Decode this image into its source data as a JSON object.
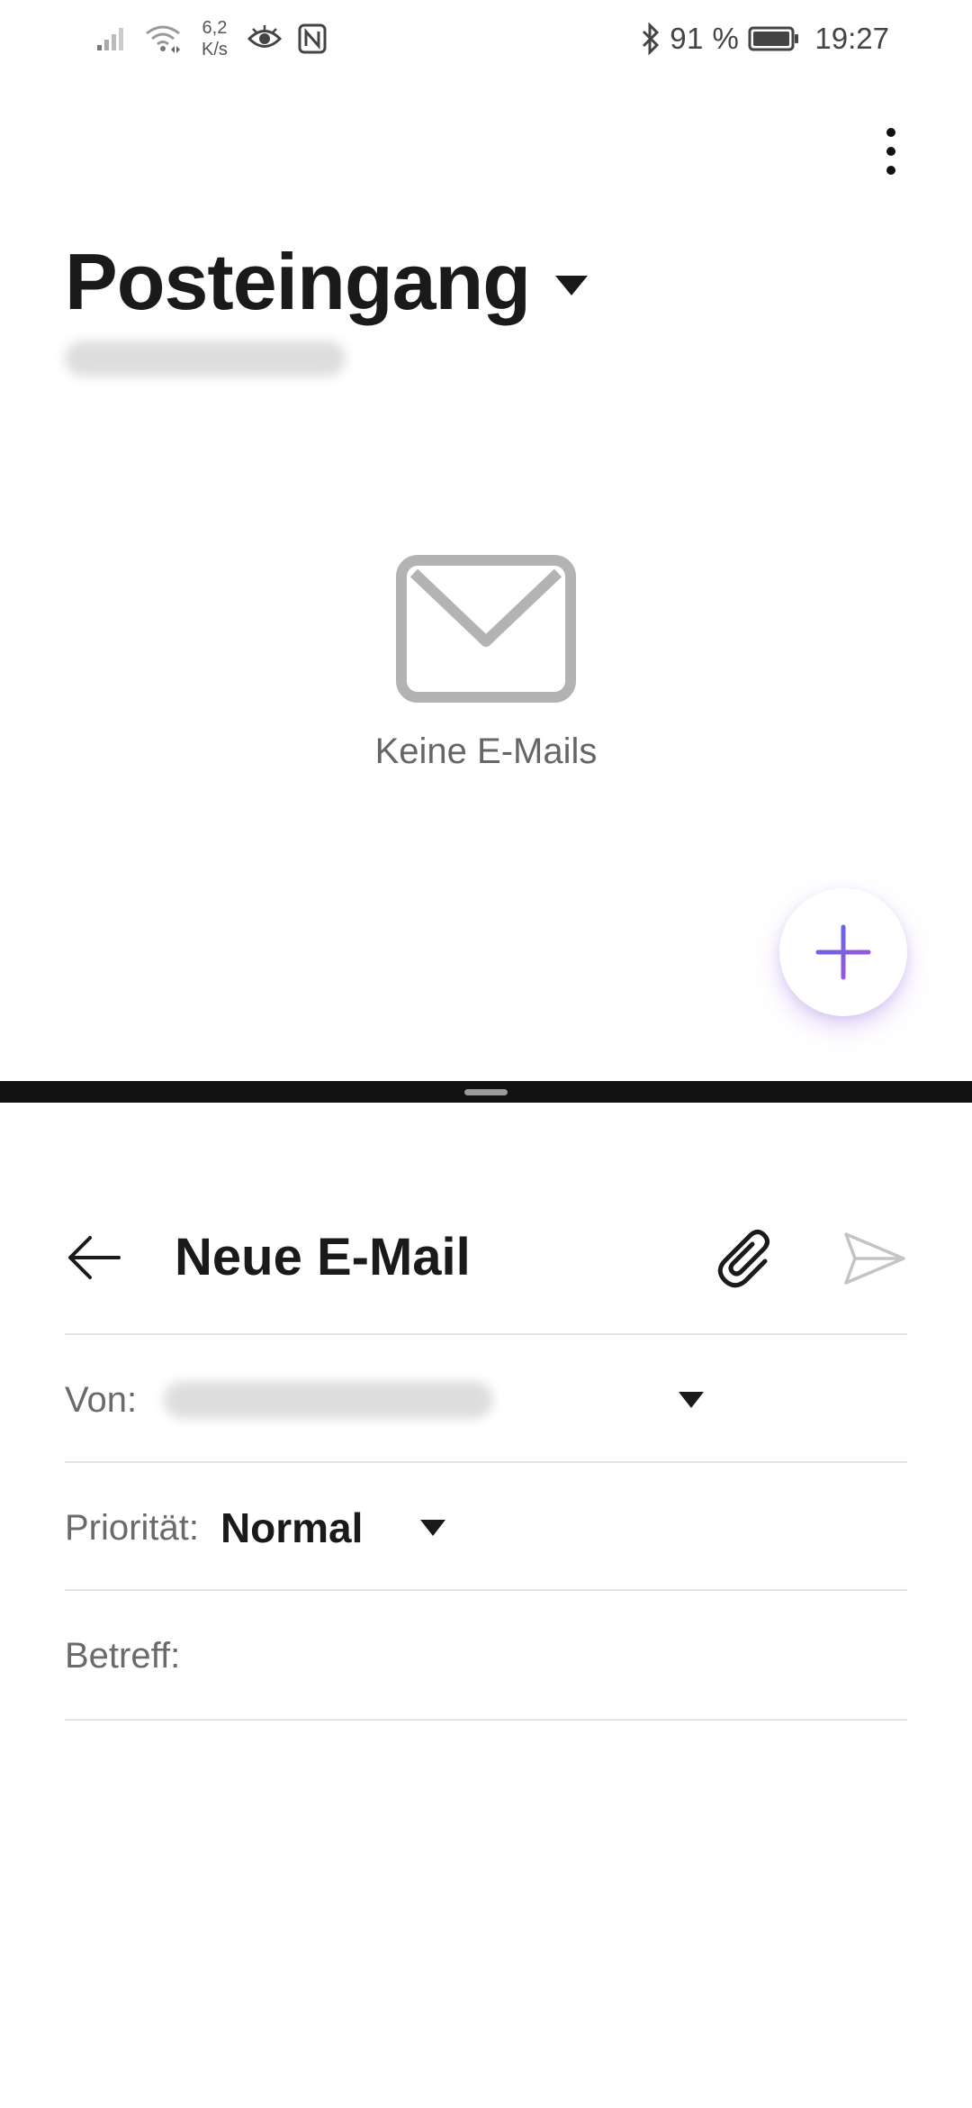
{
  "status_bar": {
    "speed_value": "6,2",
    "speed_unit": "K/s",
    "battery_percent": "91 %",
    "time": "19:27",
    "icons": [
      "signal-icon",
      "wifi-icon",
      "eye-icon",
      "nfc-icon",
      "bluetooth-icon",
      "battery-icon"
    ]
  },
  "inbox": {
    "title": "Posteingang",
    "empty_message": "Keine E-Mails",
    "icons": [
      "more-vert-icon",
      "chevron-down-icon",
      "mail-icon",
      "plus-icon"
    ]
  },
  "compose": {
    "title": "Neue E-Mail",
    "from_label": "Von:",
    "priority_label": "Priorität:",
    "priority_value": "Normal",
    "subject_label": "Betreff:",
    "icons": [
      "back-arrow-icon",
      "attachment-icon",
      "send-icon"
    ]
  },
  "colors": {
    "accent_gradient_start": "#4f6ce8",
    "accent_gradient_end": "#b24fd8",
    "text_primary": "#1a1a1a",
    "text_secondary": "#6a6a6a"
  }
}
